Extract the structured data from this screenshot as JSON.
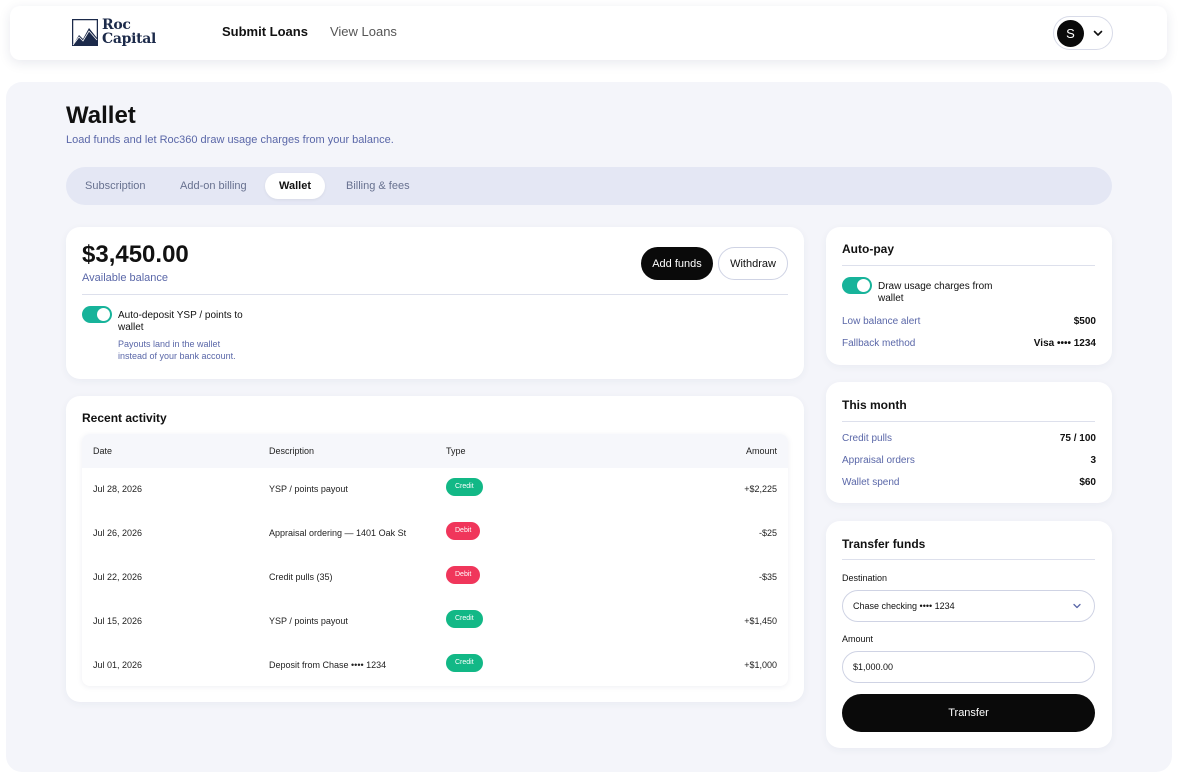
{
  "brand": {
    "name_line1": "Roc",
    "name_line2": "Capital"
  },
  "nav": {
    "submit": "Submit Loans",
    "view": "View Loans"
  },
  "user": {
    "initial": "S"
  },
  "page": {
    "title": "Wallet",
    "subtitle": "Load funds and let Roc360 draw usage charges from your balance."
  },
  "tabs": [
    {
      "label": "Subscription",
      "active": false
    },
    {
      "label": "Add-on billing",
      "active": false
    },
    {
      "label": "Wallet",
      "active": true
    },
    {
      "label": "Billing & fees",
      "active": false
    }
  ],
  "wallet": {
    "balance": "$3,450.00",
    "balance_label": "Available balance",
    "add_funds": "Add funds",
    "withdraw": "Withdraw",
    "auto_deposit_label": "Auto-deposit YSP / points to wallet",
    "auto_deposit_on": true,
    "hint_line1": "Payouts land in the wallet",
    "hint_line2": "instead of your bank account."
  },
  "activity": {
    "title": "Recent activity",
    "columns": [
      "Date",
      "Description",
      "Type",
      "Amount"
    ],
    "rows": [
      {
        "date": "Jul 28, 2026",
        "description": "YSP / points payout",
        "type": "Credit",
        "amount": "+$2,225"
      },
      {
        "date": "Jul 26, 2026",
        "description": "Appraisal ordering — 1401 Oak St",
        "type": "Debit",
        "amount": "-$25"
      },
      {
        "date": "Jul 22, 2026",
        "description": "Credit pulls (35)",
        "type": "Debit",
        "amount": "-$35"
      },
      {
        "date": "Jul 15, 2026",
        "description": "YSP / points payout",
        "type": "Credit",
        "amount": "+$1,450"
      },
      {
        "date": "Jul 01, 2026",
        "description": "Deposit from Chase •••• 1234",
        "type": "Credit",
        "amount": "+$1,000"
      }
    ]
  },
  "autopay": {
    "title": "Auto-pay",
    "toggle_label_line1": "Draw usage charges from",
    "toggle_label_line2": "wallet",
    "toggle_on": true,
    "low_balance_label": "Low balance alert",
    "low_balance_value": "$500",
    "fallback_label": "Fallback method",
    "fallback_value": "Visa •••• 1234"
  },
  "month": {
    "title": "This month",
    "credit_pulls_label": "Credit pulls",
    "credit_pulls_value": "75 / 100",
    "appraisal_label": "Appraisal orders",
    "appraisal_value": "3",
    "spend_label": "Wallet spend",
    "spend_value": "$60"
  },
  "transfer": {
    "title": "Transfer funds",
    "destination_label": "Destination",
    "destination_value": "Chase checking •••• 1234",
    "amount_label": "Amount",
    "amount_value": "$1,000.00",
    "button": "Transfer"
  },
  "colors": {
    "accent": "#17b39a",
    "credit": "#12b886",
    "debit": "#f0365b",
    "link_text": "#5a67a8"
  }
}
